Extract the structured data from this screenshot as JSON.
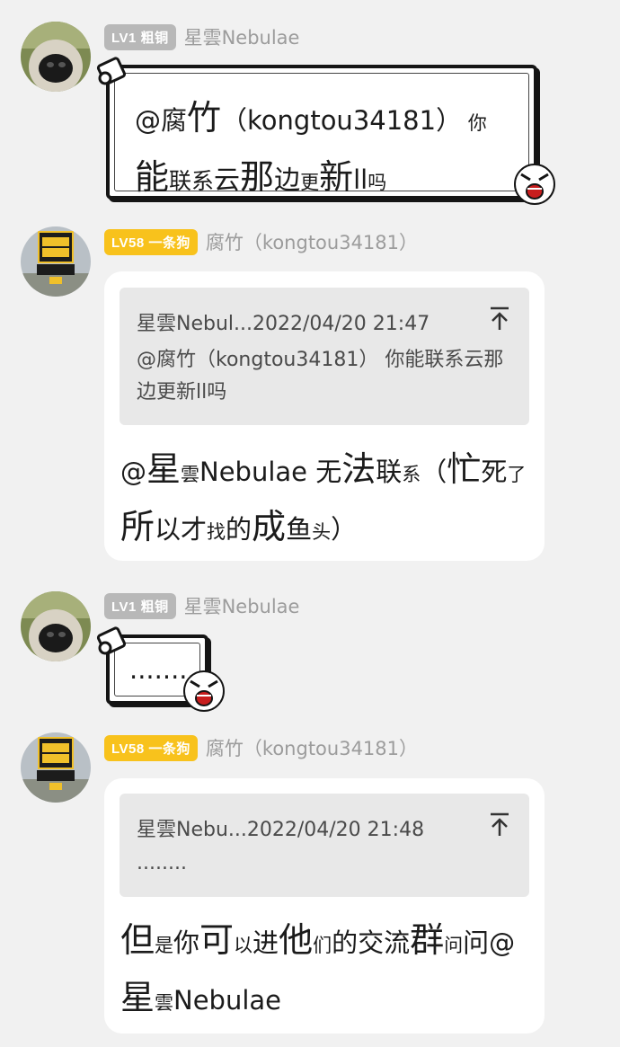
{
  "messages": [
    {
      "user": {
        "level_badge": "LV1 粗铜",
        "nickname": "星雲Nebulae",
        "avatar_icon": "dog-nose-avatar"
      },
      "bubble_style": "comic",
      "text_runs": [
        {
          "t": "@腐",
          "s": "mid"
        },
        {
          "t": "竹",
          "s": "big"
        },
        {
          "t": "（kongtou34181）",
          "s": "mid"
        },
        {
          "t": " 你",
          "s": "sm"
        },
        {
          "t": "能",
          "s": "big"
        },
        {
          "t": "联系",
          "s": "s25"
        },
        {
          "t": "云",
          "s": "mid"
        },
        {
          "t": "那",
          "s": "big"
        },
        {
          "t": "边",
          "s": "mid"
        },
        {
          "t": "更",
          "s": "sm"
        },
        {
          "t": "新",
          "s": "big"
        },
        {
          "t": "ll",
          "s": "mid"
        },
        {
          "t": "吗",
          "s": "sm"
        }
      ]
    },
    {
      "user": {
        "level_badge": "LV58 一条狗",
        "nickname": "腐竹（kongtou34181）",
        "avatar_icon": "tower-avatar"
      },
      "bubble_style": "card",
      "quote": {
        "header": "星雲Nebul...2022/04/20 21:47",
        "body": "@腐竹（kongtou34181） 你能联系云那边更新ll吗",
        "icon": "back-to-top-icon"
      },
      "text_runs": [
        {
          "t": "@",
          "s": "mid"
        },
        {
          "t": "星",
          "s": "big"
        },
        {
          "t": "雲",
          "s": "sm"
        },
        {
          "t": "Nebulae ",
          "s": "mid"
        },
        {
          "t": "无",
          "s": "mid"
        },
        {
          "t": "法",
          "s": "big"
        },
        {
          "t": "联",
          "s": "mid"
        },
        {
          "t": "系",
          "s": "sm"
        },
        {
          "t": "（",
          "s": "mid"
        },
        {
          "t": "忙",
          "s": "big"
        },
        {
          "t": "死",
          "s": "mid"
        },
        {
          "t": "了",
          "s": "sm"
        },
        {
          "t": "所",
          "s": "big"
        },
        {
          "t": "以才",
          "s": "mid"
        },
        {
          "t": "找",
          "s": "sm"
        },
        {
          "t": "的",
          "s": "mid"
        },
        {
          "t": "成",
          "s": "big"
        },
        {
          "t": "鱼",
          "s": "mid"
        },
        {
          "t": "头",
          "s": "sm"
        },
        {
          "t": "）",
          "s": "mid"
        }
      ]
    },
    {
      "user": {
        "level_badge": "LV1 粗铜",
        "nickname": "星雲Nebulae",
        "avatar_icon": "dog-nose-avatar"
      },
      "bubble_style": "comic",
      "text_runs": [
        {
          "t": "........",
          "s": "mid"
        }
      ]
    },
    {
      "user": {
        "level_badge": "LV58 一条狗",
        "nickname": "腐竹（kongtou34181）",
        "avatar_icon": "tower-avatar"
      },
      "bubble_style": "card",
      "quote": {
        "header": "星雲Nebu...2022/04/20 21:48",
        "body": "........",
        "icon": "back-to-top-icon"
      },
      "text_runs": [
        {
          "t": "但",
          "s": "big"
        },
        {
          "t": "是",
          "s": "sm"
        },
        {
          "t": "你",
          "s": "mid"
        },
        {
          "t": "可",
          "s": "big"
        },
        {
          "t": "以",
          "s": "sm"
        },
        {
          "t": "进",
          "s": "mid"
        },
        {
          "t": "他",
          "s": "big"
        },
        {
          "t": "们",
          "s": "sm"
        },
        {
          "t": "的交流",
          "s": "mid"
        },
        {
          "t": "群",
          "s": "big"
        },
        {
          "t": "问",
          "s": "sm"
        },
        {
          "t": "问",
          "s": "mid"
        },
        {
          "t": "@",
          "s": "mid"
        },
        {
          "t": "星",
          "s": "big"
        },
        {
          "t": "雲",
          "s": "sm"
        },
        {
          "t": "Nebulae",
          "s": "mid"
        }
      ]
    }
  ],
  "colors": {
    "background": "#f1f1f1",
    "badge_lv1": "#b8b8b8",
    "badge_lv58": "#f8c21c",
    "nickname": "#9c9c9c",
    "quote_bg": "#e8e8e8"
  }
}
